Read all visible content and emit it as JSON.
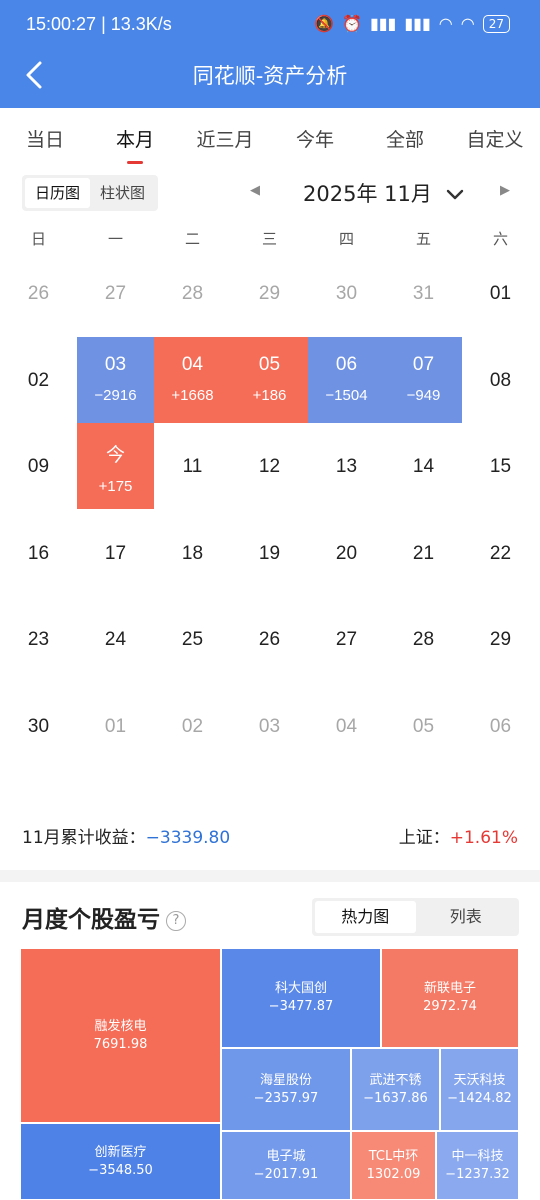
{
  "status": {
    "time": "15:00:27",
    "speed": "13.3K/s",
    "battery": "27"
  },
  "header": {
    "title": "同花顺-资产分析"
  },
  "tabs": [
    "当日",
    "本月",
    "近三月",
    "今年",
    "全部",
    "自定义"
  ],
  "view_toggle": {
    "calendar": "日历图",
    "bar": "柱状图"
  },
  "month_label": "2025年 11月",
  "weekdays": [
    "日",
    "一",
    "二",
    "三",
    "四",
    "五",
    "六"
  ],
  "calendar": [
    [
      {
        "d": "26",
        "m": true
      },
      {
        "d": "27",
        "m": true
      },
      {
        "d": "28",
        "m": true
      },
      {
        "d": "29",
        "m": true
      },
      {
        "d": "30",
        "m": true
      },
      {
        "d": "31",
        "m": true
      },
      {
        "d": "01"
      }
    ],
    [
      {
        "d": "02"
      },
      {
        "d": "03",
        "v": "−2916",
        "t": "down"
      },
      {
        "d": "04",
        "v": "+1668",
        "t": "up"
      },
      {
        "d": "05",
        "v": "+186",
        "t": "up"
      },
      {
        "d": "06",
        "v": "−1504",
        "t": "down"
      },
      {
        "d": "07",
        "v": "−949",
        "t": "down"
      },
      {
        "d": "08"
      }
    ],
    [
      {
        "d": "09"
      },
      {
        "d": "今",
        "v": "+175",
        "t": "up"
      },
      {
        "d": "11"
      },
      {
        "d": "12"
      },
      {
        "d": "13"
      },
      {
        "d": "14"
      },
      {
        "d": "15"
      }
    ],
    [
      {
        "d": "16"
      },
      {
        "d": "17"
      },
      {
        "d": "18"
      },
      {
        "d": "19"
      },
      {
        "d": "20"
      },
      {
        "d": "21"
      },
      {
        "d": "22"
      }
    ],
    [
      {
        "d": "23"
      },
      {
        "d": "24"
      },
      {
        "d": "25"
      },
      {
        "d": "26"
      },
      {
        "d": "27"
      },
      {
        "d": "28"
      },
      {
        "d": "29"
      }
    ],
    [
      {
        "d": "30"
      },
      {
        "d": "01",
        "m": true
      },
      {
        "d": "02",
        "m": true
      },
      {
        "d": "03",
        "m": true
      },
      {
        "d": "04",
        "m": true
      },
      {
        "d": "05",
        "m": true
      },
      {
        "d": "06",
        "m": true
      }
    ]
  ],
  "summary": {
    "label": "11月累计收益：",
    "value": "−3339.80",
    "index_label": "上证：",
    "index_value": "+1.61%"
  },
  "section": {
    "title": "月度个股盈亏",
    "heatmap": "热力图",
    "list": "列表"
  },
  "stocks": [
    {
      "name": "融发核电",
      "value": "7691.98",
      "color": "#f56c57"
    },
    {
      "name": "创新医疗",
      "value": "−3548.50",
      "color": "#4f82e6"
    },
    {
      "name": "科大国创",
      "value": "−3477.87",
      "color": "#5a88e8"
    },
    {
      "name": "新联电子",
      "value": "2972.74",
      "color": "#f57a65"
    },
    {
      "name": "海星股份",
      "value": "−2357.97",
      "color": "#6f97ea"
    },
    {
      "name": "武进不锈",
      "value": "−1637.86",
      "color": "#7ea1ec"
    },
    {
      "name": "天沃科技",
      "value": "−1424.82",
      "color": "#85a6ed"
    },
    {
      "name": "电子城",
      "value": "−2017.91",
      "color": "#749aeb"
    },
    {
      "name": "TCL中环",
      "value": "1302.09",
      "color": "#f68a77"
    },
    {
      "name": "中一科技",
      "value": "−1237.32",
      "color": "#8aa9ee"
    }
  ]
}
